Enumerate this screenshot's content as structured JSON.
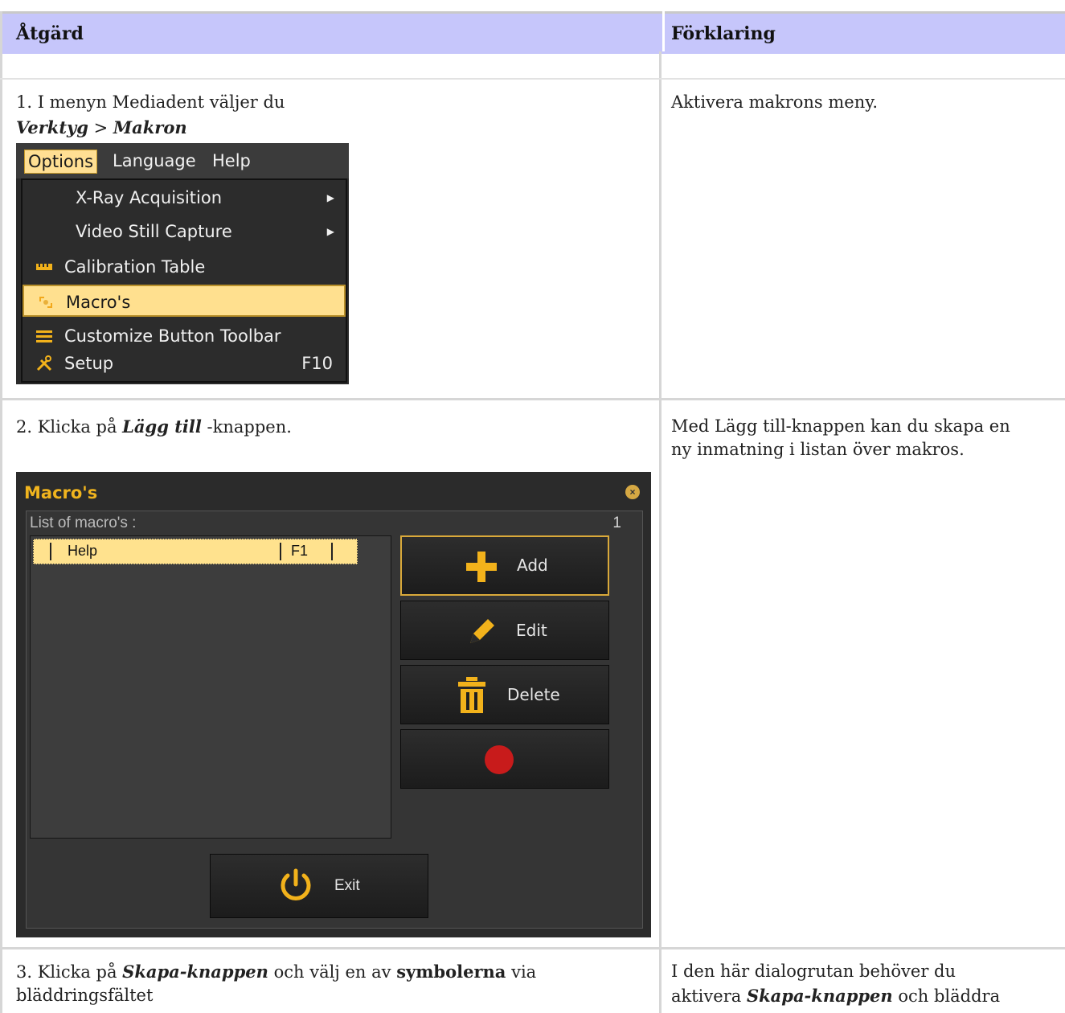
{
  "table": {
    "col1_header": "Åtgärd",
    "col2_header": "Förklaring"
  },
  "row1": {
    "line1": "1. I menyn Mediadent väljer du",
    "path_a": "Verktyg",
    "path_sep": " > ",
    "path_b": "Makron",
    "explanation": "Aktivera makrons meny."
  },
  "menu": {
    "bar": [
      "Options",
      "Language",
      "Help"
    ],
    "items": [
      {
        "label": "X-Ray Acquisition",
        "has_submenu": true
      },
      {
        "label": "Video Still Capture",
        "has_submenu": true
      },
      {
        "label": "Calibration Table",
        "icon": "ruler-icon"
      },
      {
        "label": "Macro's",
        "icon": "macro-icon",
        "highlighted": true
      },
      {
        "label": "Customize Button Toolbar",
        "icon": "hamburger-icon"
      },
      {
        "label": "Setup",
        "icon": "tools-icon",
        "shortcut": "F10"
      }
    ]
  },
  "row2": {
    "line_pre": "2. Klicka på ",
    "line_bold": "Lägg till",
    "line_post": " -knappen.",
    "explanation_1": "Med Lägg till-knappen kan du skapa en",
    "explanation_2": "ny inmatning i listan över makros."
  },
  "dialog": {
    "title": "Macro's",
    "list_label": "List of macro's :",
    "count": "1",
    "rows": [
      {
        "name": "Help",
        "key": "F1"
      }
    ],
    "buttons": {
      "add": "Add",
      "edit": "Edit",
      "delete": "Delete",
      "exit": "Exit"
    },
    "accent": "#f0b41e"
  },
  "row3": {
    "pre": "3. Klicka på ",
    "bold1": "Skapa-knappen",
    "mid": " och välj en av ",
    "bold2": "symbolerna",
    "post": " via",
    "line2": "bläddringsfältet",
    "explanation_1": "I den här dialogrutan behöver du",
    "exp2_pre": "aktivera ",
    "exp2_bold": "Skapa-knappen",
    "exp2_post": " och bläddra"
  }
}
